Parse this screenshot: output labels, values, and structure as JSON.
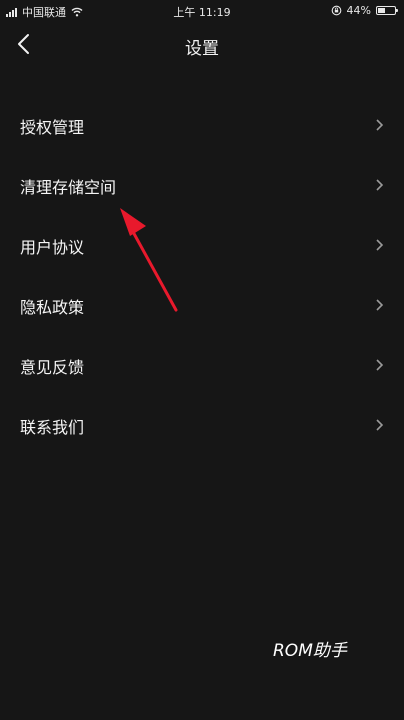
{
  "status_bar": {
    "carrier": "中国联通",
    "time": "上午 11:19",
    "battery": "44%",
    "battery_level": 0.44,
    "icons": [
      "signal-icon",
      "wifi-icon",
      "lock-rotation-icon",
      "battery-icon"
    ]
  },
  "nav": {
    "title": "设置",
    "back_icon": "back-chevron-icon"
  },
  "menu": {
    "items": [
      {
        "label": "授权管理"
      },
      {
        "label": "清理存储空间"
      },
      {
        "label": "用户协议"
      },
      {
        "label": "隐私政策"
      },
      {
        "label": "意见反馈"
      },
      {
        "label": "联系我们"
      }
    ],
    "chevron_icon": "chevron-right-icon"
  },
  "watermark": {
    "text": "ROM助手"
  },
  "colors": {
    "background": "#161616",
    "text": "#f5f5f5",
    "chevron": "#9a9a9a",
    "annotation_arrow": "#e8192c"
  }
}
